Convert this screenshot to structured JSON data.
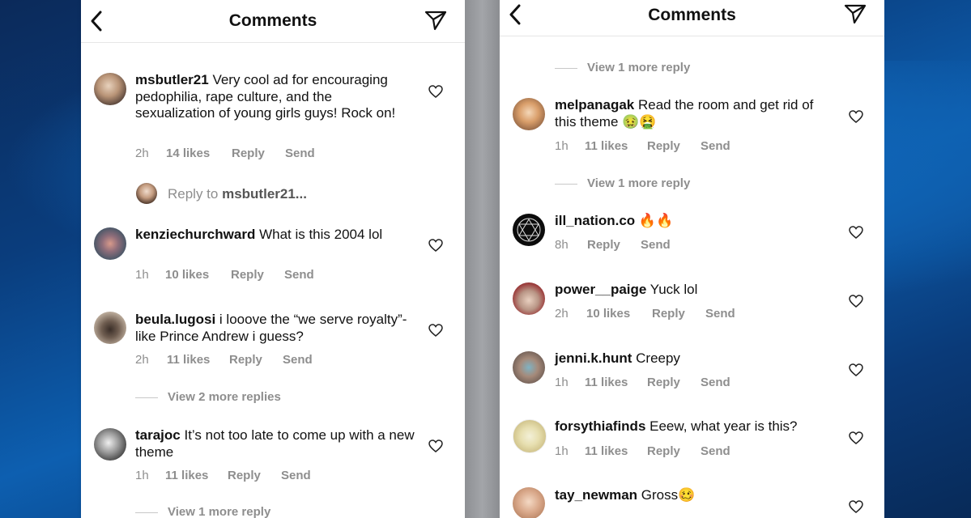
{
  "left": {
    "header_title": "Comments",
    "comments": [
      {
        "user": "msbutler21",
        "text": "Very cool ad for encouraging pedophilia, rape culture, and the sexualization of young girls guys! Rock on!",
        "time": "2h",
        "likes": "14 likes",
        "reply": "Reply",
        "send": "Send"
      },
      {
        "user": "kenziechurchward",
        "text": "What is this 2004 lol",
        "time": "1h",
        "likes": "10 likes",
        "reply": "Reply",
        "send": "Send"
      },
      {
        "user": "beula.lugosi",
        "text": "i looove the “we serve royalty”- like Prince Andrew i guess?",
        "time": "2h",
        "likes": "11 likes",
        "reply": "Reply",
        "send": "Send"
      },
      {
        "user": "tarajoc",
        "text": "It’s not too late to come up with a new theme",
        "time": "1h",
        "likes": "11 likes",
        "reply": "Reply",
        "send": "Send"
      }
    ],
    "reply_prompt": "Reply to ",
    "reply_target": "msbutler21...",
    "view_more_1": "View 2 more replies",
    "view_more_2": "View 1 more reply"
  },
  "right": {
    "header_title": "Comments",
    "view_more_top": "View 1 more reply",
    "view_more_mid": "View 1 more reply",
    "comments": [
      {
        "user": "melpanagak",
        "text": "Read the room and get rid of this theme 🤢🤮",
        "time": "1h",
        "likes": "11 likes",
        "reply": "Reply",
        "send": "Send"
      },
      {
        "user": "ill_nation.co",
        "text": "🔥🔥",
        "time": "8h",
        "likes": "",
        "reply": "Reply",
        "send": "Send"
      },
      {
        "user": "power__paige",
        "text": "Yuck lol",
        "time": "2h",
        "likes": "10 likes",
        "reply": "Reply",
        "send": "Send"
      },
      {
        "user": "jenni.k.hunt",
        "text": "Creepy",
        "time": "1h",
        "likes": "11 likes",
        "reply": "Reply",
        "send": "Send"
      },
      {
        "user": "forsythiafinds",
        "text": "Eeew, what year is this?",
        "time": "1h",
        "likes": "11 likes",
        "reply": "Reply",
        "send": "Send"
      },
      {
        "user": "tay_newman",
        "text": "Gross🥴",
        "time": "",
        "likes": "",
        "reply": "",
        "send": ""
      }
    ]
  },
  "icons": {
    "back": "chevron-left-icon",
    "send": "paper-plane-icon",
    "like": "heart-outline-icon"
  },
  "colors": {
    "meta_gray": "#8e8e8e",
    "text": "#111111",
    "backdrop_blue": "#0d5fb0"
  }
}
